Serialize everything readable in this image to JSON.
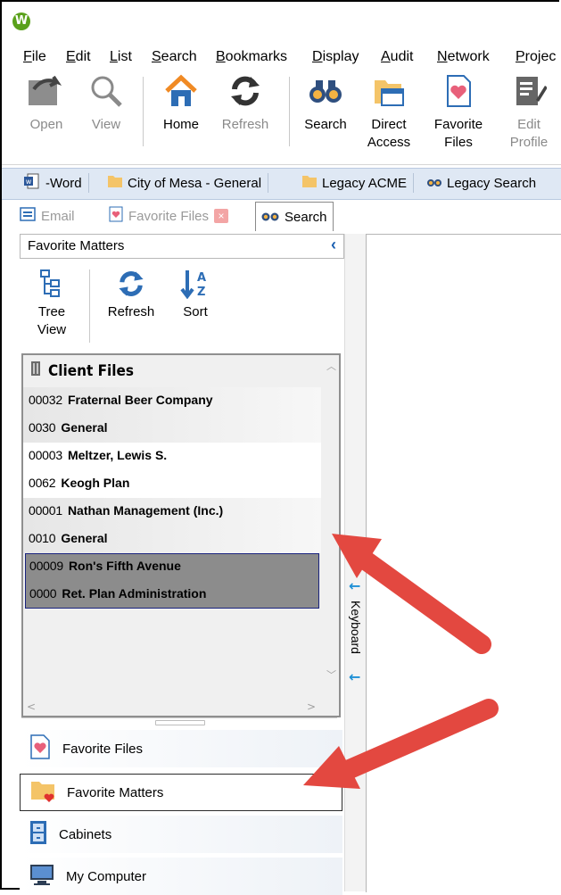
{
  "app": {
    "logo_letter": "W"
  },
  "menu": [
    "File",
    "Edit",
    "List",
    "Search",
    "Bookmarks",
    "Display",
    "Audit",
    "Network",
    "Projec"
  ],
  "toolbar": [
    {
      "label": "Open",
      "icon": "open-folder-icon",
      "disabled": true
    },
    {
      "label": "View",
      "icon": "magnifier-icon",
      "disabled": true
    },
    {
      "label": "Home",
      "icon": "home-icon",
      "disabled": false
    },
    {
      "label": "Refresh",
      "icon": "refresh-icon",
      "disabled": true
    },
    {
      "label": "Search",
      "icon": "binoculars-icon",
      "disabled": false
    },
    {
      "label": "Direct Access",
      "line1": "Direct",
      "line2": "Access",
      "icon": "folder-window-icon",
      "disabled": false
    },
    {
      "label": "Favorite Files",
      "line1": "Favorite",
      "line2": "Files",
      "icon": "favorite-files-icon",
      "disabled": false
    },
    {
      "label": "Edit Profile",
      "line1": "Edit",
      "line2": "Profile",
      "icon": "edit-profile-icon",
      "disabled": true
    }
  ],
  "doc_tabs": [
    {
      "label": "-Word",
      "icon": "word-doc-icon"
    },
    {
      "label": "City of Mesa - General",
      "icon": "folder-icon"
    },
    {
      "label": "Legacy ACME",
      "icon": "folder-icon"
    },
    {
      "label": "Legacy Search",
      "icon": "binoculars-icon"
    }
  ],
  "sub_tabs": [
    {
      "label": "Email",
      "active": false
    },
    {
      "label": "Favorite Files",
      "active": false
    },
    {
      "label": "Search",
      "active": true
    }
  ],
  "panel": {
    "title": "Favorite Matters",
    "collapse_glyph": "‹",
    "tools": [
      {
        "label_1": "Tree",
        "label_2": "View",
        "icon": "tree-view-icon"
      },
      {
        "label_1": "Refresh",
        "label_2": "",
        "icon": "refresh-icon"
      },
      {
        "label_1": "Sort",
        "label_2": "",
        "icon": "sort-az-icon"
      }
    ],
    "list_title": "Client Files",
    "items": [
      {
        "client_num": "00032",
        "client": "Fraternal Beer Company",
        "matter_num": "0030",
        "matter": "General",
        "style": "shade"
      },
      {
        "client_num": "00003",
        "client": "Meltzer, Lewis S.",
        "matter_num": "0062",
        "matter": "Keogh Plan",
        "style": "white"
      },
      {
        "client_num": "00001",
        "client": "Nathan Management (Inc.)",
        "matter_num": "0010",
        "matter": "General",
        "style": "shade"
      },
      {
        "client_num": "00009",
        "client": "Ron's Fifth Avenue",
        "matter_num": "0000",
        "matter": "Ret. Plan Administration",
        "style": "selected"
      }
    ]
  },
  "nav": [
    {
      "label": "Favorite Files",
      "icon": "favorite-files-icon",
      "active": false
    },
    {
      "label": "Favorite Matters",
      "icon": "favorite-matters-icon",
      "active": true
    },
    {
      "label": "Cabinets",
      "icon": "cabinet-icon",
      "active": false
    },
    {
      "label": "My Computer",
      "icon": "computer-icon",
      "active": false
    }
  ],
  "side_strip": {
    "label": "Keyboard",
    "arrow": "←"
  },
  "colors": {
    "annotation_arrow": "#e34840",
    "selection": "#8c8c8c",
    "selection_border": "#1a237e",
    "accent_blue": "#1a5fb0"
  }
}
